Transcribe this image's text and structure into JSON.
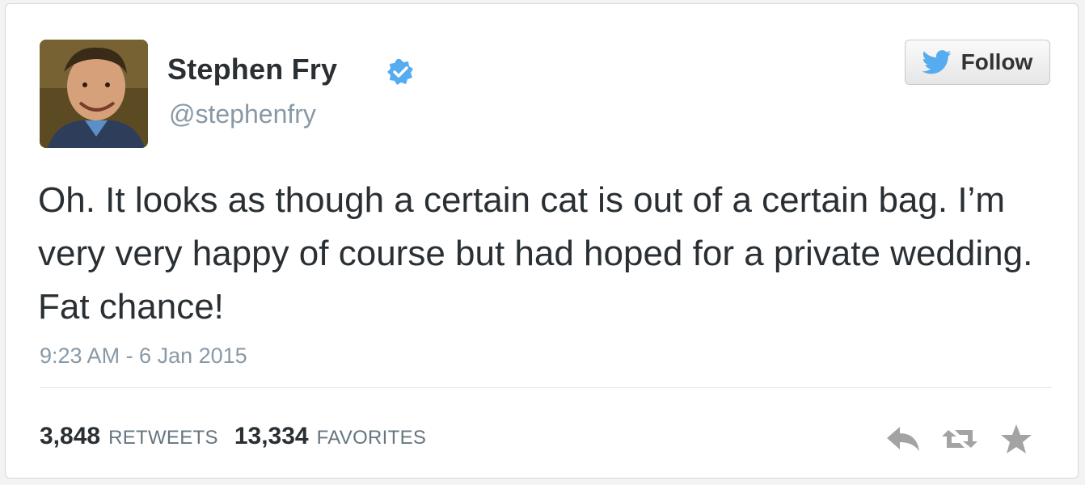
{
  "tweet": {
    "author": {
      "display_name": "Stephen Fry",
      "handle": "@stephenfry",
      "verified": true
    },
    "follow_button": {
      "label": "Follow",
      "icon": "twitter-bird-icon"
    },
    "text": "Oh. It looks as though a certain cat is out of a certain bag. I’m very very happy of course but had hoped for a private wedding. Fat chance!",
    "timestamp": "9:23 AM - 6 Jan 2015",
    "stats": {
      "retweets": {
        "count": "3,848",
        "label": "RETWEETS"
      },
      "favorites": {
        "count": "13,334",
        "label": "FAVORITES"
      }
    },
    "actions": [
      "reply-icon",
      "retweet-icon",
      "favorite-star-icon"
    ]
  },
  "colors": {
    "verified_badge": "#55acee",
    "twitter_blue": "#55acee",
    "text_primary": "#292f33",
    "text_secondary": "#8899a6",
    "action_icon": "#a3a3a3"
  }
}
